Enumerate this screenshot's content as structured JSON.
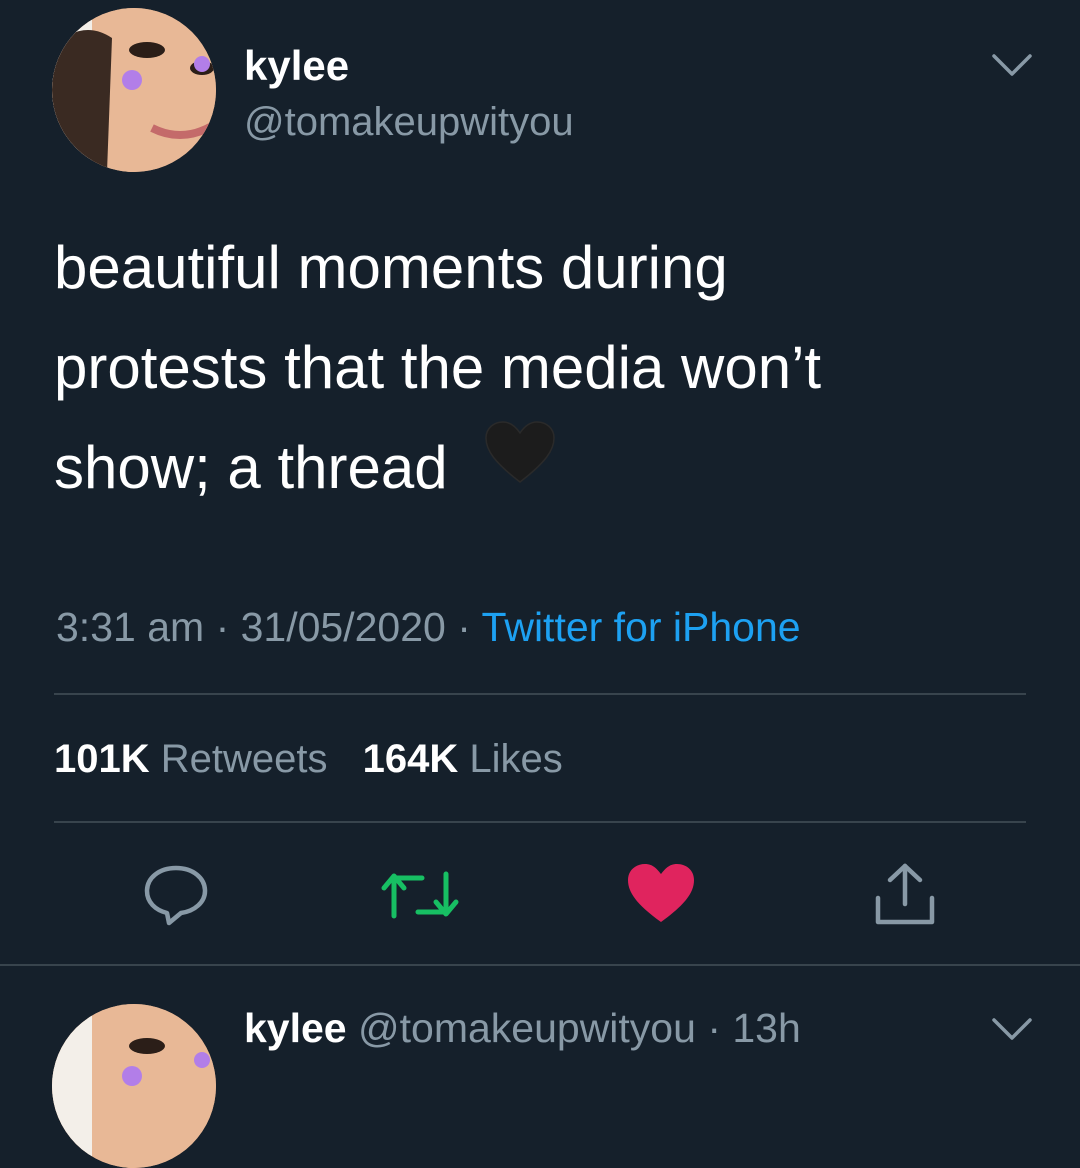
{
  "tweet": {
    "author_name": "kylee",
    "author_handle": "@tomakeupwityou",
    "text_lines": [
      "beautiful moments during",
      "protests that the media won’t",
      "show; a thread"
    ],
    "emoji": "black-heart",
    "time": "3:31 am",
    "sep": "·",
    "date": "31/05/2020",
    "source": "Twitter for iPhone",
    "retweets_count": "101K",
    "retweets_label": "Retweets",
    "likes_count": "164K",
    "likes_label": "Likes",
    "liked": true
  },
  "actions": [
    {
      "name": "reply-icon",
      "color": "#8899a6"
    },
    {
      "name": "retweet-icon",
      "color": "#17bf63"
    },
    {
      "name": "like-icon",
      "color": "#e0245e"
    },
    {
      "name": "share-icon",
      "color": "#8899a6"
    }
  ],
  "reply": {
    "author_name": "kylee",
    "author_handle": "@tomakeupwityou",
    "sep": "·",
    "time": "13h"
  },
  "colors": {
    "background": "#15202b",
    "secondary_text": "#8899a6",
    "link": "#1da1f2",
    "divider": "#38444d"
  }
}
